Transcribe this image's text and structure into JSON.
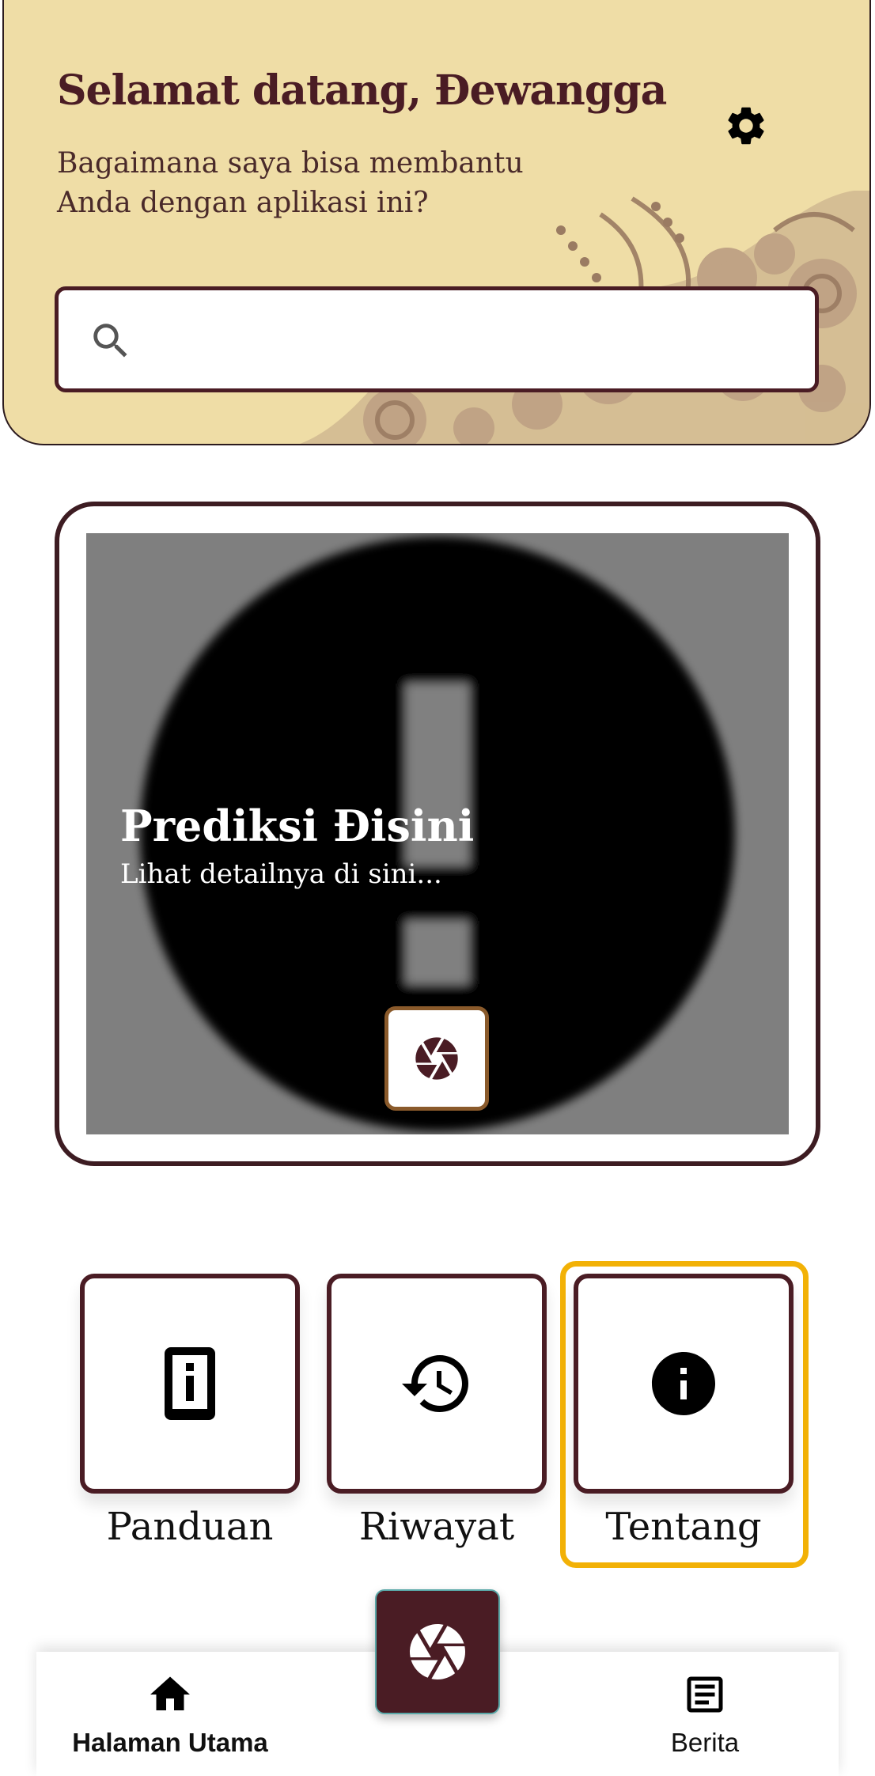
{
  "header": {
    "greeting": "Selamat datang, Đewangga",
    "subtitle": "Bagaimana saya bisa membantu Anda dengan aplikasi ini?",
    "search_placeholder": ""
  },
  "prediction_card": {
    "title": "Prediksi Đisini",
    "subtitle": "Lihat detailnya di sini..."
  },
  "menu": [
    {
      "label": "Panduan",
      "icon": "guide-phone-info-icon"
    },
    {
      "label": "Riwayat",
      "icon": "history-icon"
    },
    {
      "label": "Tentang",
      "icon": "info-icon",
      "focused": true
    }
  ],
  "bottom_nav": {
    "home_label": "Halaman Utama",
    "news_label": "Berita"
  },
  "colors": {
    "primary": "#4a1c24",
    "header_bg": "#efdda6",
    "focus": "#f2b106"
  }
}
